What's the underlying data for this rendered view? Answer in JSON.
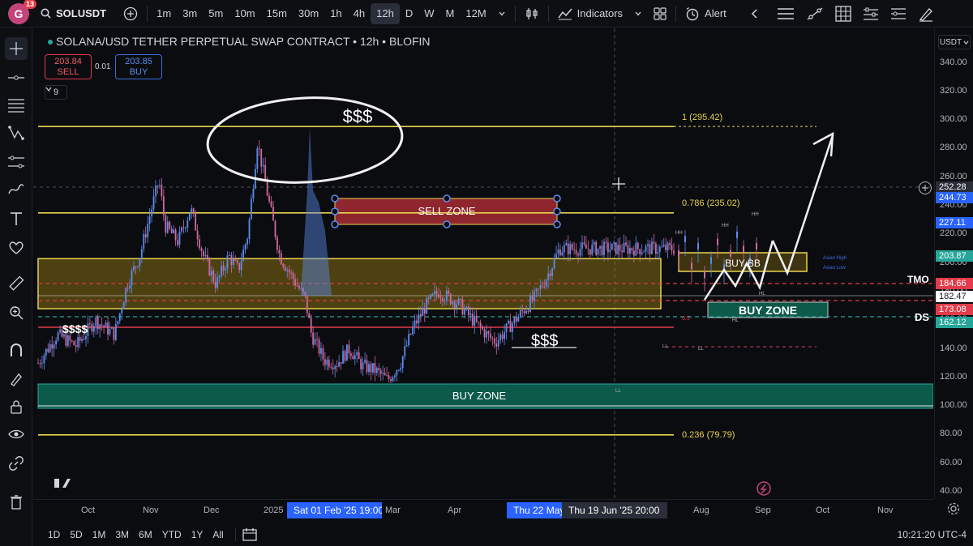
{
  "topbar": {
    "avatar_letter": "G",
    "notifications": "13",
    "symbol": "SOLUSDT",
    "intervals": [
      "1m",
      "3m",
      "5m",
      "10m",
      "15m",
      "30m",
      "1h",
      "4h",
      "12h",
      "D",
      "W",
      "M",
      "12M"
    ],
    "active_interval": "12h",
    "indicators_label": "Indicators",
    "alert_label": "Alert"
  },
  "legend": {
    "title": "SOLANA/USD TETHER PERPETUAL SWAP CONTRACT • 12h • BLOFIN",
    "sell_price": "203.84",
    "sell_label": "SELL",
    "spread": "0.01",
    "buy_price": "203.85",
    "buy_label": "BUY",
    "indicator_count": "9"
  },
  "annotations": {
    "sell_zone": "SELL ZONE",
    "buy_zone_main": "BUY ZONE",
    "buy_zone_small": "BUY ZONE",
    "buy_bb": "BUY BB",
    "money_top": "$$$",
    "money_left": "$$$$",
    "money_mid": "$$$",
    "fib_1": "1 (295.42)",
    "fib_0786": "0.786 (235.02)",
    "fib_0236": "0.236 (79.79)",
    "tmo": "TMO",
    "ds": "DS",
    "hh1": "HH",
    "hh2": "HH",
    "hh3": "HH",
    "hl1": "HL",
    "hl2": "HL",
    "ll1": "LL",
    "ll2": "LL",
    "ll3": "LL",
    "asian_high": "Asian High",
    "asian_low": "Asian Low",
    "fib_05": "0.5"
  },
  "price_scale": {
    "currency": "USDT",
    "ticks": [
      "340.00",
      "320.00",
      "300.00",
      "280.00",
      "260.00",
      "240.00",
      "220.00",
      "200.00",
      "180.00",
      "160.00",
      "140.00",
      "120.00",
      "100.00",
      "80.00",
      "60.00",
      "40.00"
    ],
    "badges": [
      {
        "label": "252.28",
        "color": "#2a2e39"
      },
      {
        "label": "244.73",
        "color": "#2962ff"
      },
      {
        "label": "227.11",
        "color": "#2962ff"
      },
      {
        "label": "203.87",
        "color": "#26a69a"
      },
      {
        "label": "184.66",
        "color": "#e23b4a"
      },
      {
        "label": "182.47",
        "color": "#ffffff"
      },
      {
        "label": "173.08",
        "color": "#e23b4a"
      },
      {
        "label": "162.12",
        "color": "#26a69a"
      }
    ]
  },
  "time_scale": {
    "ticks": [
      "Oct",
      "Nov",
      "Dec",
      "2025",
      "Mar",
      "Apr",
      "Aug",
      "Sep",
      "Oct",
      "Nov"
    ],
    "badges": [
      "Sat 01 Feb '25   19:00",
      "Thu 22 May '2",
      "Thu 19 Jun '25   20:00"
    ]
  },
  "bottombar": {
    "ranges": [
      "1D",
      "5D",
      "1M",
      "3M",
      "6M",
      "YTD",
      "1Y",
      "All"
    ],
    "clock": "10:21:20 UTC-4"
  },
  "chart_data": {
    "type": "candlestick",
    "title": "SOLANA/USD TETHER PERPETUAL SWAP CONTRACT • 12h • BLOFIN",
    "yrange": [
      40,
      340
    ],
    "horizontal_levels": [
      295.42,
      235.02,
      79.79,
      184.66,
      173.08,
      162.12
    ],
    "zones": [
      {
        "label": "SELL ZONE",
        "from": 226,
        "to": 244
      },
      {
        "label": "BUY ZONE",
        "from": 98,
        "to": 115
      },
      {
        "label": "BUY ZONE",
        "from": 162,
        "to": 172
      },
      {
        "label": "BUY BB",
        "from": 197,
        "to": 210
      }
    ],
    "price_path": [
      [
        0.0,
        130
      ],
      [
        0.03,
        150
      ],
      [
        0.06,
        142
      ],
      [
        0.09,
        160
      ],
      [
        0.12,
        150
      ],
      [
        0.14,
        185
      ],
      [
        0.16,
        205
      ],
      [
        0.175,
        232
      ],
      [
        0.19,
        258
      ],
      [
        0.2,
        226
      ],
      [
        0.22,
        215
      ],
      [
        0.24,
        238
      ],
      [
        0.26,
        205
      ],
      [
        0.28,
        185
      ],
      [
        0.3,
        205
      ],
      [
        0.315,
        195
      ],
      [
        0.33,
        220
      ],
      [
        0.345,
        285
      ],
      [
        0.36,
        250
      ],
      [
        0.38,
        205
      ],
      [
        0.4,
        190
      ],
      [
        0.42,
        175
      ],
      [
        0.43,
        150
      ],
      [
        0.45,
        132
      ],
      [
        0.47,
        130
      ],
      [
        0.49,
        140
      ],
      [
        0.51,
        128
      ],
      [
        0.53,
        125
      ],
      [
        0.55,
        118
      ],
      [
        0.57,
        130
      ],
      [
        0.59,
        155
      ],
      [
        0.61,
        170
      ],
      [
        0.63,
        180
      ],
      [
        0.66,
        172
      ],
      [
        0.69,
        157
      ],
      [
        0.71,
        148
      ],
      [
        0.72,
        145
      ],
      [
        0.74,
        155
      ],
      [
        0.76,
        165
      ],
      [
        0.78,
        175
      ],
      [
        0.8,
        190
      ],
      [
        0.82,
        210
      ]
    ]
  }
}
